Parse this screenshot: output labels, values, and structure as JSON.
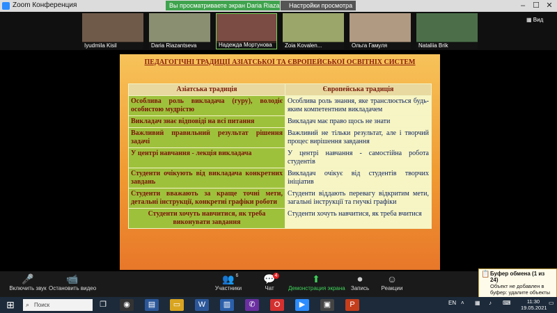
{
  "window": {
    "title": "Zoom Конференция",
    "share_banner": "Вы просматриваете экран Daria Riazantseva",
    "view_options": "Настройки просмотра",
    "controls": [
      "–",
      "☐",
      "✕"
    ]
  },
  "participants": [
    {
      "name": "Iyudmila Kisil",
      "cam_color": "#6f5a4a"
    },
    {
      "name": "Daria Riazantseva",
      "cam_color": "#8a8f72"
    },
    {
      "name": "Надежда Мортунова",
      "cam_color": "#7a4c44"
    },
    {
      "name": "Zoia Kovalen...",
      "cam_color": "#9aa66a"
    },
    {
      "name": "Ольга Гамуля",
      "cam_color": "#b09a82"
    },
    {
      "name": "Nataliia Brik",
      "cam_color": "#4c6f4a"
    }
  ],
  "gallery_label": "Вид",
  "slide": {
    "title": "ПЕДАГОГІЧНІ ТРАДИЦІЇ АЗІАТСЬКОЇ ТА ЄВРОПЕЙСЬКОЇ ОСВІТНІХ СИСТЕМ",
    "headers": [
      "Азіатська традиція",
      "Європейська традиція"
    ],
    "rows": [
      [
        "Особлива роль викладача (гуру), володіє особистою мудрістю",
        "Особлива роль знання, яке транслюється будь-яким компетентним викладачем"
      ],
      [
        "Викладач знає відповіді на всі питання",
        "Викладач має право щось не знати"
      ],
      [
        "Важливий правильний результат рішення задачі",
        "Важливий не тільки результат, але і творчий процес вирішення завдання"
      ],
      [
        "У центрі навчання - лекція викладача",
        "У центрі навчання - самостійна робота студентів"
      ],
      [
        "Студенти очікують від викладача конкретних завдань",
        "Викладач очікує від студентів творчих ініціатив"
      ],
      [
        "Студенти вважають за краще точні мети, детальні інструкції, конкретні графіки роботи",
        "Студенти віддають перевагу відкритим мети, загальні інструкції та гнучкі графіки"
      ],
      [
        "Студенти хочуть навчитися, як треба виконувати завдання",
        "Студенти хочуть навчитися, як треба вчитися"
      ]
    ]
  },
  "toolbar": {
    "unmute": "Включить звук",
    "stop_video": "Остановить видео",
    "participants": "Участники",
    "participants_count": "6",
    "chat": "Чат",
    "chat_badge": "4",
    "share": "Демонстрация экрана",
    "record": "Запись",
    "reactions": "Реакции"
  },
  "clipboard": {
    "title": "Буфер обмена (1 из 24)",
    "text": "Объект не добавлен в буфер: удалите объекты для увеличения доступного места"
  },
  "taskbar": {
    "search_placeholder": "Поиск",
    "lang": "EN",
    "time": "11:30",
    "date": "19.05.2021"
  },
  "colors": {
    "zoom_blue": "#2d8cff",
    "share_green": "#3fa34d",
    "slide_orange": "#f09a32",
    "asian_cell": "#9ec13c",
    "european_cell": "#f7f5c3"
  }
}
